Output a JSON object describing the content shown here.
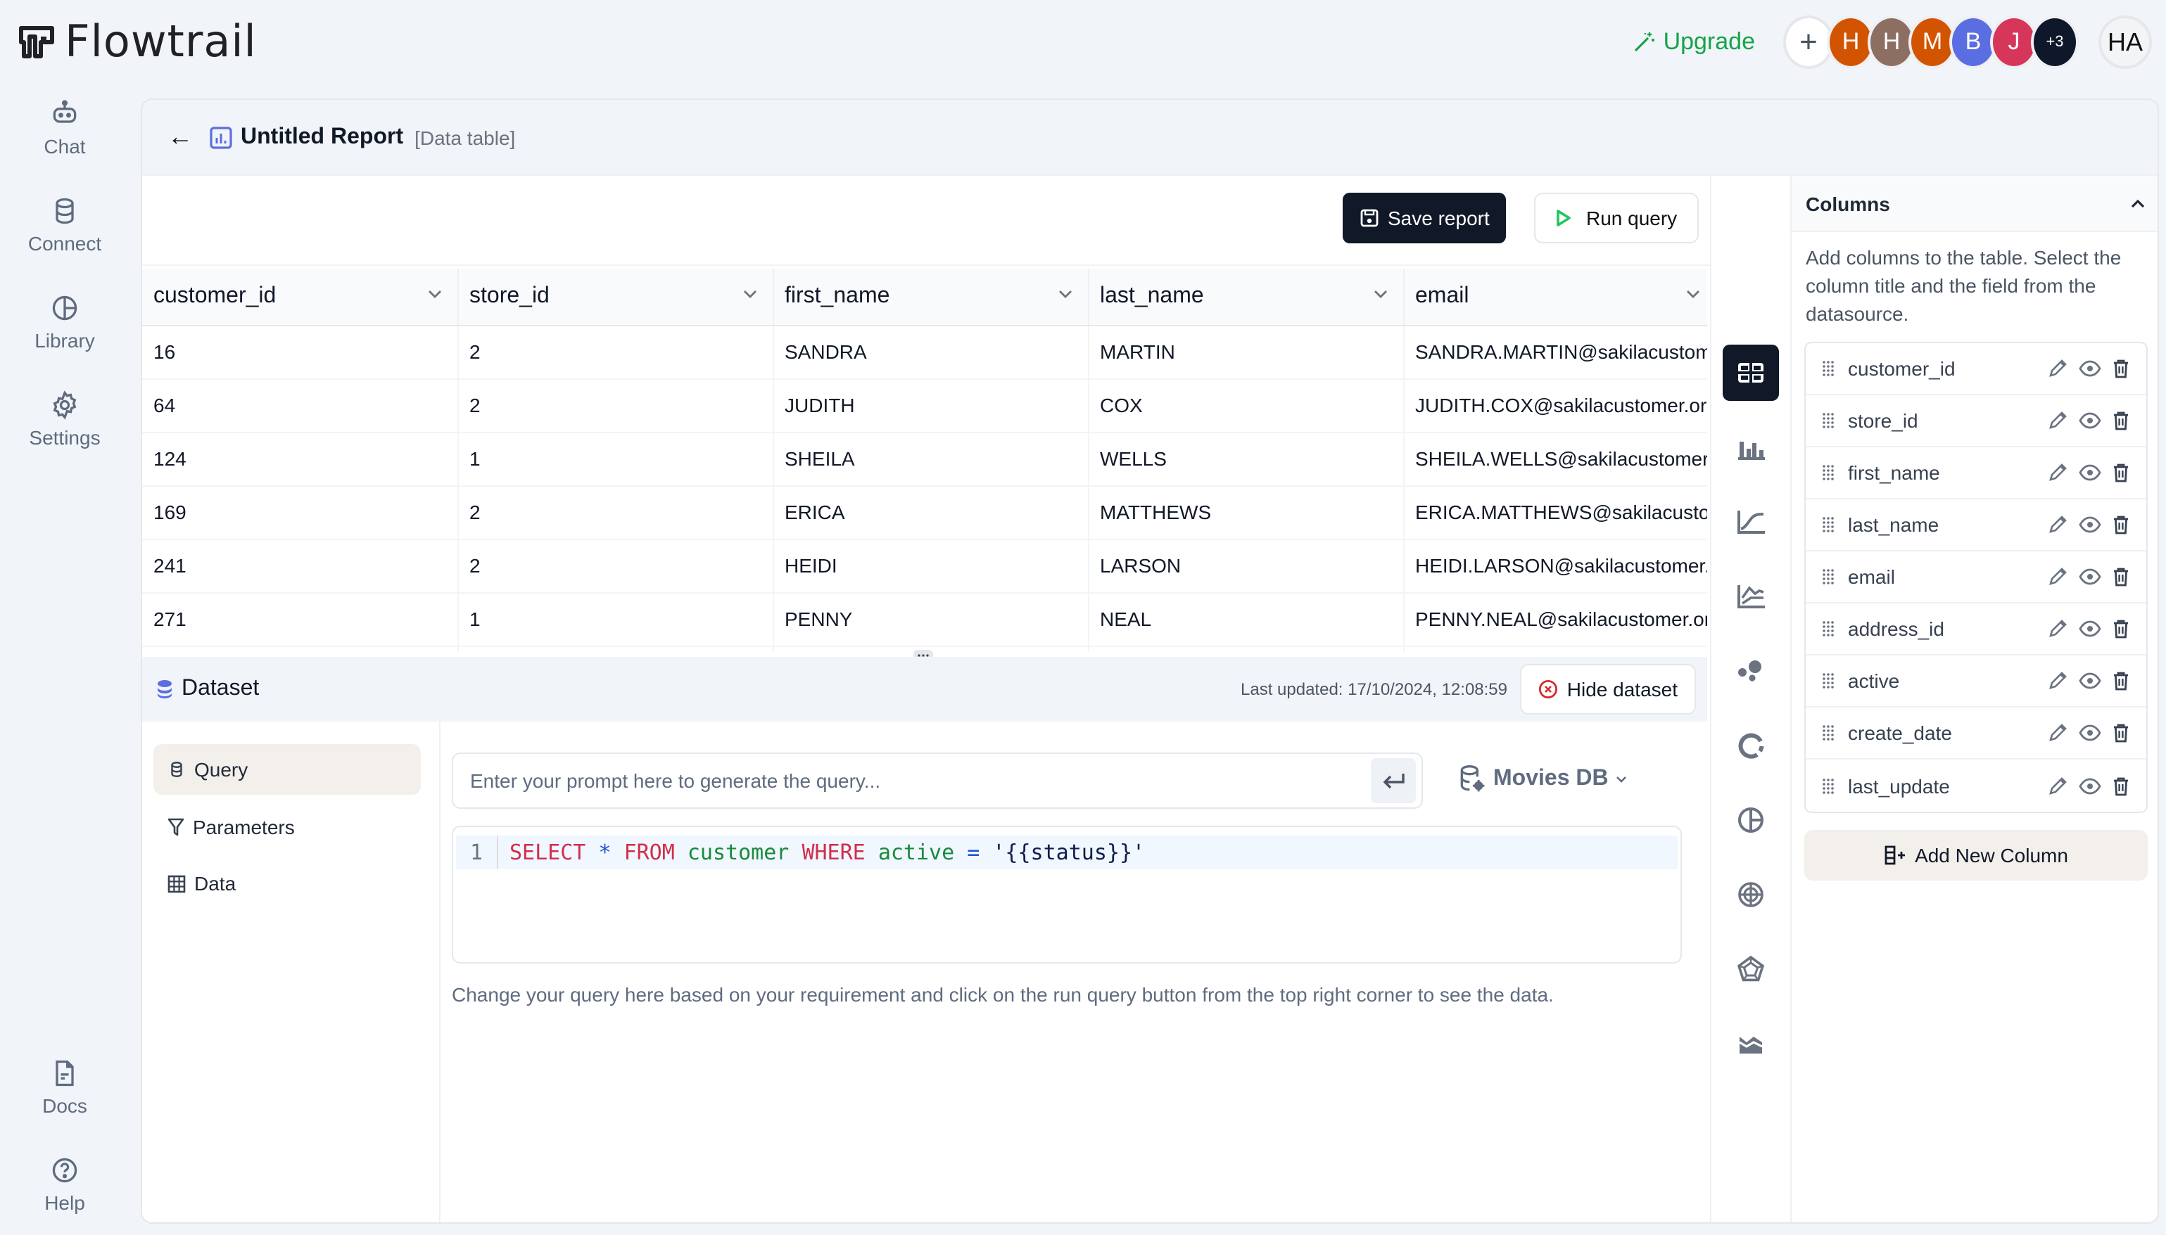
{
  "app": {
    "name": "Flowtrail"
  },
  "topbar": {
    "upgrade_label": "Upgrade",
    "add_member_label": "+",
    "avatars": [
      {
        "initial": "H",
        "color": "#d35400"
      },
      {
        "initial": "H",
        "color": "#8d6e63"
      },
      {
        "initial": "M",
        "color": "#d35400"
      },
      {
        "initial": "B",
        "color": "#5b6ee1"
      },
      {
        "initial": "J",
        "color": "#d6365a"
      }
    ],
    "more_count": "+3",
    "user_initials": "HA"
  },
  "sidebar": {
    "items": [
      {
        "label": "Chat",
        "icon": "robot-icon"
      },
      {
        "label": "Connect",
        "icon": "database-icon"
      },
      {
        "label": "Library",
        "icon": "pie-chart-icon"
      },
      {
        "label": "Settings",
        "icon": "gear-icon"
      }
    ],
    "bottom_items": [
      {
        "label": "Docs",
        "icon": "document-icon"
      },
      {
        "label": "Help",
        "icon": "help-circle-icon"
      }
    ]
  },
  "header": {
    "title": "Untitled Report",
    "subtitle": "[Data table]"
  },
  "actions": {
    "save_label": "Save report",
    "run_label": "Run query"
  },
  "table": {
    "columns": [
      "customer_id",
      "store_id",
      "first_name",
      "last_name",
      "email"
    ],
    "rows": [
      [
        "16",
        "2",
        "SANDRA",
        "MARTIN",
        "SANDRA.MARTIN@sakilacustomer.org"
      ],
      [
        "64",
        "2",
        "JUDITH",
        "COX",
        "JUDITH.COX@sakilacustomer.org"
      ],
      [
        "124",
        "1",
        "SHEILA",
        "WELLS",
        "SHEILA.WELLS@sakilacustomer.org"
      ],
      [
        "169",
        "2",
        "ERICA",
        "MATTHEWS",
        "ERICA.MATTHEWS@sakilacustomer.org"
      ],
      [
        "241",
        "2",
        "HEIDI",
        "LARSON",
        "HEIDI.LARSON@sakilacustomer.org"
      ],
      [
        "271",
        "1",
        "PENNY",
        "NEAL",
        "PENNY.NEAL@sakilacustomer.org"
      ]
    ]
  },
  "dataset": {
    "title": "Dataset",
    "last_updated": "Last updated: 17/10/2024, 12:08:59",
    "hide_label": "Hide dataset",
    "tabs": [
      {
        "label": "Query",
        "icon": "database-icon",
        "active": true
      },
      {
        "label": "Parameters",
        "icon": "filter-icon",
        "active": false
      },
      {
        "label": "Data",
        "icon": "grid-icon",
        "active": false
      }
    ],
    "prompt_placeholder": "Enter your prompt here to generate the query...",
    "prompt_value": "",
    "datasource": "Movies DB",
    "editor": {
      "line_number": "1",
      "tokens": [
        {
          "t": "SELECT",
          "c": "kw"
        },
        {
          "t": " ",
          "c": ""
        },
        {
          "t": "*",
          "c": "op"
        },
        {
          "t": " ",
          "c": ""
        },
        {
          "t": "FROM",
          "c": "kw"
        },
        {
          "t": " ",
          "c": ""
        },
        {
          "t": "customer",
          "c": "id"
        },
        {
          "t": " ",
          "c": ""
        },
        {
          "t": "WHERE",
          "c": "kw"
        },
        {
          "t": " ",
          "c": ""
        },
        {
          "t": "active",
          "c": "id"
        },
        {
          "t": " ",
          "c": ""
        },
        {
          "t": "=",
          "c": "op"
        },
        {
          "t": " ",
          "c": ""
        },
        {
          "t": "'{{status}}'",
          "c": "str"
        }
      ]
    },
    "hint": "Change your query here based on your requirement and click on the run query button from the top right corner to see the data."
  },
  "chart_types": [
    {
      "name": "table",
      "active": true
    },
    {
      "name": "bar",
      "active": false
    },
    {
      "name": "line",
      "active": false
    },
    {
      "name": "multi-line",
      "active": false
    },
    {
      "name": "bubble",
      "active": false
    },
    {
      "name": "donut",
      "active": false
    },
    {
      "name": "pie",
      "active": false
    },
    {
      "name": "polar",
      "active": false
    },
    {
      "name": "radar",
      "active": false
    },
    {
      "name": "area",
      "active": false
    }
  ],
  "columns_panel": {
    "title": "Columns",
    "description": "Add columns to the table. Select the column title and the field from the datasource.",
    "items": [
      "customer_id",
      "store_id",
      "first_name",
      "last_name",
      "email",
      "address_id",
      "active",
      "create_date",
      "last_update"
    ],
    "add_label": "Add New Column"
  },
  "colors": {
    "accent": "#5b6ee1",
    "upgrade": "#16a34a",
    "primary_button": "#111827",
    "run_icon": "#22c55e",
    "danger": "#dc2626"
  }
}
